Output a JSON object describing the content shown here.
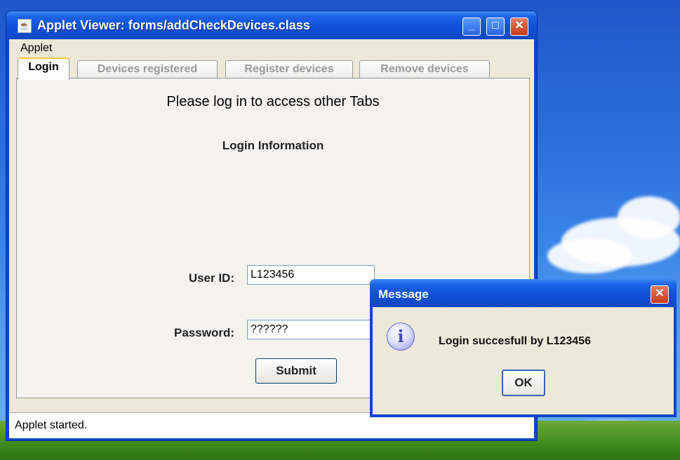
{
  "applet_window": {
    "title": "Applet Viewer: forms/addCheckDevices.class",
    "icon": "java-cup-icon"
  },
  "menubar": {
    "applet_label": "Applet"
  },
  "tabs": [
    {
      "label": "Login",
      "active": true
    },
    {
      "label": "Devices registered",
      "active": false
    },
    {
      "label": "Register devices",
      "active": false
    },
    {
      "label": "Remove devices",
      "active": false
    }
  ],
  "login_panel": {
    "heading": "Please log in to access other Tabs",
    "section_title": "Login Information",
    "user_id_label": "User ID:",
    "user_id_value": "L123456",
    "password_label": "Password:",
    "password_value": "??????",
    "submit_label": "Submit"
  },
  "status": {
    "text": "Applet started."
  },
  "message_dialog": {
    "title": "Message",
    "text": "Login succesfull by L123456",
    "ok_label": "OK",
    "icon": "info-icon"
  },
  "colors": {
    "titlebar": "#0f4fd6",
    "window_body": "#ece9d8",
    "active_tab_accent": "#ffc83c"
  }
}
